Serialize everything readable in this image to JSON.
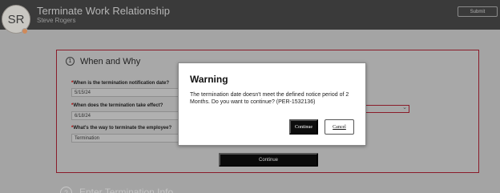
{
  "header": {
    "avatar_initials": "SR",
    "title": "Terminate Work Relationship",
    "subtitle": "Steve Rogers",
    "submit_label": "Submit"
  },
  "section1": {
    "number": "1",
    "title": "When and Why",
    "fields": [
      {
        "label": "When is the termination notification date?",
        "value": "5/15/24"
      },
      {
        "label": "When does the termination take effect?",
        "value": "6/18/24"
      },
      {
        "label": "What's the way to terminate the employee?",
        "value": "Termination"
      }
    ],
    "continue_label": "Continue"
  },
  "section2": {
    "number": "2",
    "title": "Enter Termination Info"
  },
  "dialog": {
    "title": "Warning",
    "message": "The termination date doesn't meet the defined notice period of 2 Months. Do you want to continue? (PER-1532136)",
    "continue_label": "Continue",
    "cancel_label": "Cancel"
  },
  "colors": {
    "header_bg": "#3a3a3a",
    "page_bg": "#a4a4a4",
    "section_border": "#8a1c2a",
    "primary_button": "#0a0a0a",
    "dialog_bg": "#ffffff"
  }
}
